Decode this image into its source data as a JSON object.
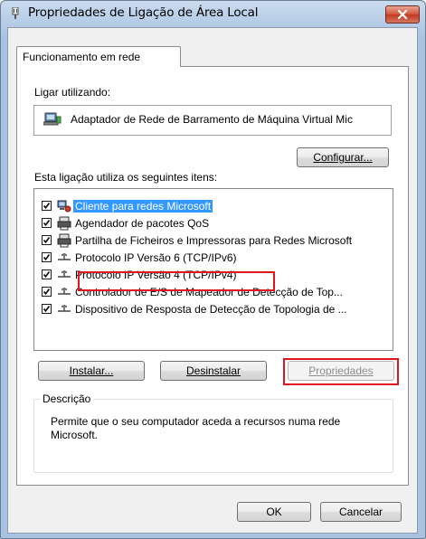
{
  "window": {
    "title": "Propriedades de Ligação de Área Local",
    "close_icon": "close-icon"
  },
  "tabs": [
    {
      "label": "Funcionamento em rede",
      "active": true
    }
  ],
  "connect_using": {
    "label": "Ligar utilizando:",
    "adapter_name": "Adaptador de Rede de Barramento de Máquina Virtual Mic",
    "adapter_icon": "network-adapter-icon"
  },
  "configure_button": {
    "label": "Configurar..."
  },
  "items_label": "Esta ligação utiliza os seguintes itens:",
  "items": [
    {
      "label": "Cliente para redes Microsoft",
      "checked": true,
      "selected": true,
      "icon": "network-client-icon"
    },
    {
      "label": "Agendador de pacotes QoS",
      "checked": true,
      "selected": false,
      "icon": "network-service-icon"
    },
    {
      "label": "Partilha de Ficheiros e Impressoras para Redes Microsoft",
      "checked": true,
      "selected": false,
      "icon": "network-service-icon"
    },
    {
      "label": "Protocolo IP Versão 6 (TCP/IPv6)",
      "checked": true,
      "selected": false,
      "icon": "network-protocol-icon"
    },
    {
      "label": "Protocolo IP Versão 4 (TCP/IPv4)",
      "checked": true,
      "selected": false,
      "icon": "network-protocol-icon",
      "highlighted": true
    },
    {
      "label": "Controlador de E/S de Mapeador de Detecção de Top...",
      "checked": true,
      "selected": false,
      "icon": "network-protocol-icon"
    },
    {
      "label": "Dispositivo de Resposta de Detecção de Topologia de ...",
      "checked": true,
      "selected": false,
      "icon": "network-protocol-icon"
    }
  ],
  "buttons": {
    "install": "Instalar...",
    "uninstall": "Desinstalar",
    "properties": "Propriedades",
    "ok": "OK",
    "cancel": "Cancelar"
  },
  "description": {
    "legend": "Descrição",
    "text": "Permite que o seu computador aceda a recursos numa rede Microsoft."
  },
  "colors": {
    "highlight": "#e0141d",
    "selection": "#3399ff",
    "title_bar": "#b9cfe8"
  }
}
